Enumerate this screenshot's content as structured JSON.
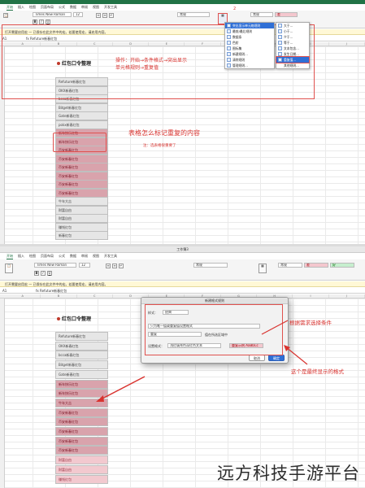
{
  "top": {
    "tabs": [
      "开始",
      "插入",
      "绘图",
      "页面布局",
      "公式",
      "数据",
      "审阅",
      "视图",
      "开发工具"
    ],
    "font_name": "Times New Roman",
    "font_size": "12",
    "number_format": "常规",
    "style_normal": "常规",
    "style_bad": "差",
    "notice": "打开需要启用宏 — 已保存在此文件中的宏。若要使用宏，请启用内容。",
    "name_box": "A1",
    "formula_text": "fx  Refuture新春红包",
    "sheet_title": "红包口令整理",
    "cells": [
      "Refuture新春红包",
      "OKX新春红包",
      "bcca新春红包",
      "Bitget新春红包",
      "Gate新春红包",
      "pokx新春红包",
      "新年快乐红包",
      "新年快乐红包",
      "币安新春红包",
      "币安新春红包",
      "币安新春红包",
      "币安新春红包",
      "币安新春红包",
      "币安新春红包",
      "牛年大吉",
      "财富自由",
      "财富自由",
      "赚钱红包",
      "新春红包"
    ],
    "annotation_steps": "操作：开始→条件格式→突出显示\n单元格规则→重复值",
    "annotation_question": "表格怎么标记重复的内容",
    "annotation_note": "注：选表格很重要了",
    "menu1": [
      "突出显示单元格规则",
      "最前/最后规则",
      "数据条",
      "色阶",
      "图标集",
      "新建规则...",
      "清除规则",
      "管理规则..."
    ],
    "menu2": [
      "大于...",
      "小于...",
      "介于...",
      "等于...",
      "文本包含...",
      "发生日期...",
      "重复值...",
      "其他规则..."
    ],
    "badge_number": "2",
    "badge_selected": "重复值..."
  },
  "bottom": {
    "window_title": "工作簿3",
    "tabs": [
      "开始",
      "插入",
      "绘图",
      "页面布局",
      "公式",
      "数据",
      "审阅",
      "视图",
      "开发工具"
    ],
    "font_name": "Times New Roman",
    "font_size": "12",
    "number_format": "常规",
    "style_normal": "常规",
    "style_bad": "差",
    "style_good": "好",
    "notice": "打开需要启用宏 — 已保存在此文件中的宏。若要使用宏，请启用内容。",
    "name_box": "A1",
    "formula_text": "fx  Refuture新春红包",
    "sheet_title": "红包口令整理",
    "cells": [
      "Refuture新春红包",
      "OKX新春红包",
      "bcca新春红包",
      "Bitget新春红包",
      "Gate新春红包",
      "新年快乐红包",
      "新年快乐红包",
      "牛年大吉",
      "币安新春红包",
      "币安新春红包",
      "币安新春红包",
      "币安新春红包",
      "币安新春红包",
      "财富自由",
      "财富自由",
      "赚钱红包"
    ],
    "dialog": {
      "title": "新建格式规则",
      "style_label": "样式：",
      "style_value": "经典",
      "rule_type": "只为唯一值或重复值设置格式",
      "dup_value": "重复",
      "dup_suffix": "值在所选区域中",
      "format_label": "设置格式：",
      "format_value": "浅红填充色深红色文本",
      "preview": "重复示例 AaBbCc",
      "cancel": "取消",
      "ok": "确定"
    },
    "annotation_choose": "根据需求选择条件",
    "annotation_final": "这个是最终显示的格式"
  },
  "watermark": "远方科技手游平台",
  "colors": {
    "excel_green": "#217346",
    "annotation_red": "#d9332f",
    "dup_fill": "#d9a3ac",
    "select_blue": "#2f6fd6"
  }
}
